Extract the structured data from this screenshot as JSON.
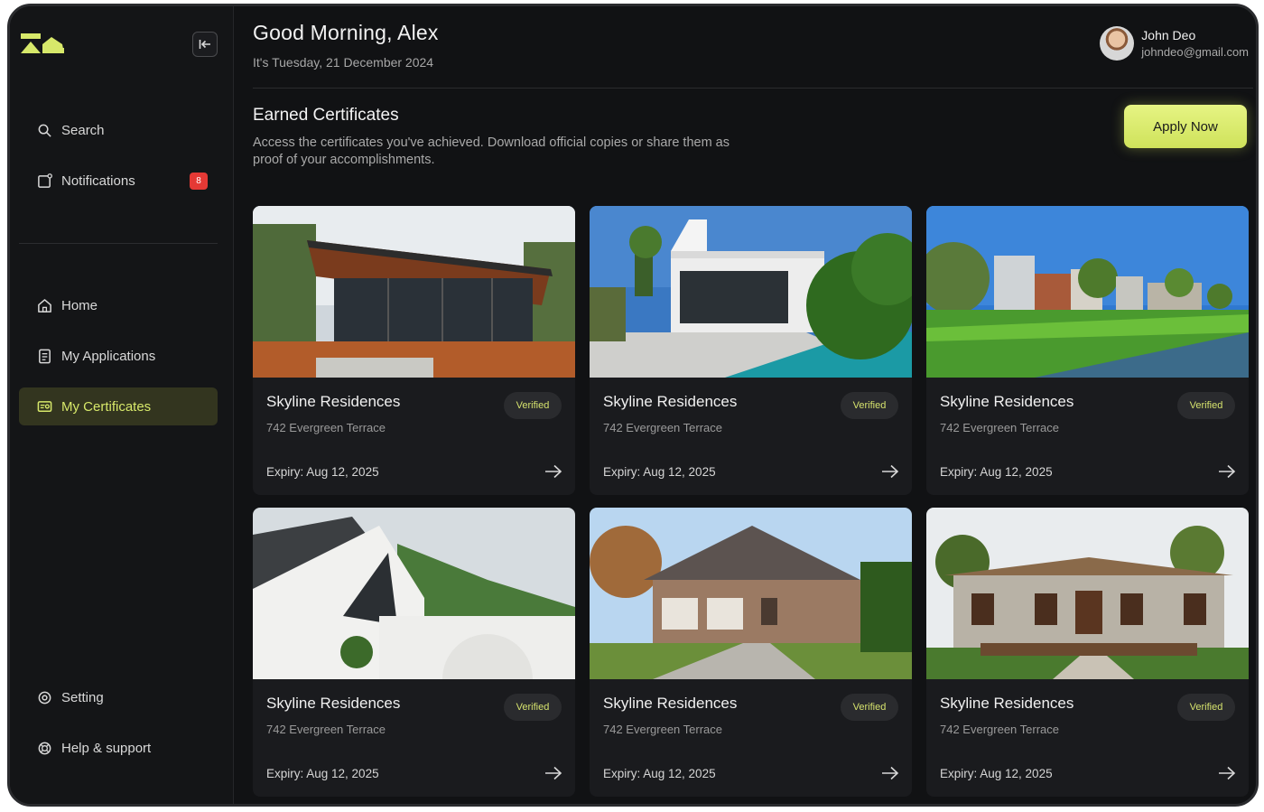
{
  "header": {
    "greeting": "Good  Morning, Alex",
    "date": "It's  Tuesday, 21 December  2024"
  },
  "user": {
    "name": "John Deo",
    "email": "johndeo@gmail.com"
  },
  "sidebar": {
    "top_items": [
      {
        "label": "Search",
        "icon": "search-icon"
      },
      {
        "label": "Notifications",
        "icon": "bell-icon",
        "badge": "8"
      }
    ],
    "main_items": [
      {
        "label": "Home",
        "icon": "home-icon"
      },
      {
        "label": "My Applications",
        "icon": "applications-icon"
      },
      {
        "label": "My Certificates",
        "icon": "certificate-icon",
        "active": true
      }
    ],
    "bottom_items": [
      {
        "label": "Setting",
        "icon": "settings-icon"
      },
      {
        "label": "Help & support",
        "icon": "help-icon"
      }
    ]
  },
  "section": {
    "title": "Earned Certificates",
    "description": "Access the certificates you've achieved. Download official copies or share them as proof of your accomplishments.",
    "apply_label": "Apply Now"
  },
  "cards": [
    {
      "title": "Skyline Residences",
      "address": "742 Evergreen Terrace",
      "expiry": "Expiry: Aug 12, 2025",
      "badge": "Verified",
      "image": "modern-wood-house"
    },
    {
      "title": "Skyline Residences",
      "address": "742 Evergreen Terrace",
      "expiry": "Expiry: Aug 12, 2025",
      "badge": "Verified",
      "image": "white-villa-pool"
    },
    {
      "title": "Skyline Residences",
      "address": "742 Evergreen Terrace",
      "expiry": "Expiry: Aug 12, 2025",
      "badge": "Verified",
      "image": "townhouses-canal"
    },
    {
      "title": "Skyline Residences",
      "address": "742 Evergreen Terrace",
      "expiry": "Expiry: Aug 12, 2025",
      "badge": "Verified",
      "image": "white-gable-house"
    },
    {
      "title": "Skyline Residences",
      "address": "742 Evergreen Terrace",
      "expiry": "Expiry: Aug 12, 2025",
      "badge": "Verified",
      "image": "brick-suburban-house"
    },
    {
      "title": "Skyline Residences",
      "address": "742 Evergreen Terrace",
      "expiry": "Expiry: Aug 12, 2025",
      "badge": "Verified",
      "image": "stone-villa-deck"
    }
  ],
  "colors": {
    "accent": "#d7e86a",
    "background": "#111214",
    "card": "#1a1b1e",
    "badge_alert": "#e53935"
  }
}
